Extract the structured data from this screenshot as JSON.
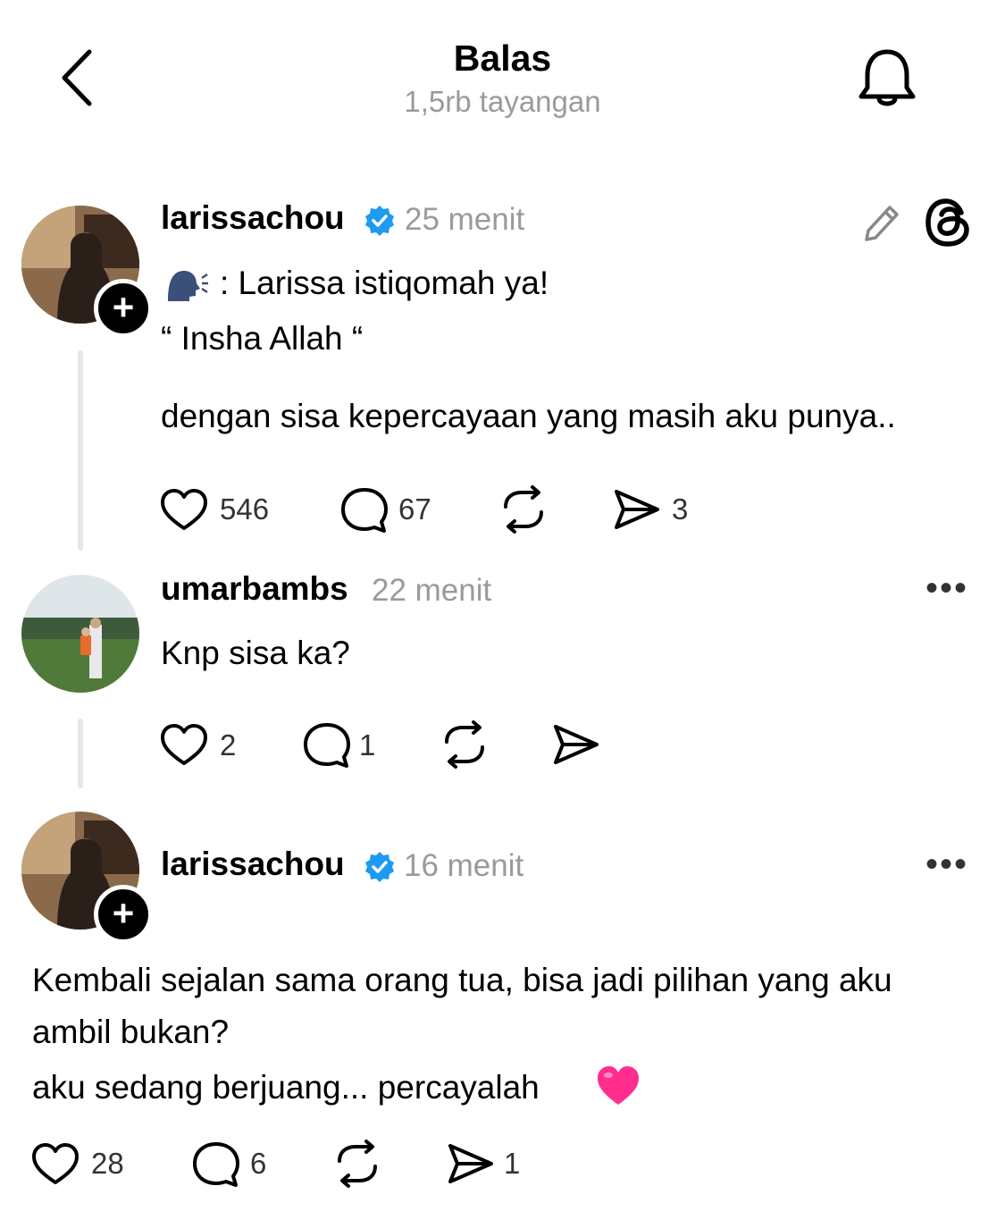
{
  "header": {
    "title": "Balas",
    "views": "1,5rb tayangan"
  },
  "posts": [
    {
      "username": "larissachou",
      "verified": true,
      "time": "25 menit",
      "lines": [
        ": Larissa istiqomah ya!",
        "“ Insha Allah “",
        "dengan sisa kepercayaan yang masih aku punya.."
      ],
      "likes": "546",
      "replies": "67",
      "shares": "3"
    },
    {
      "username": "umarbambs",
      "verified": false,
      "time": "22 menit",
      "lines": [
        "Knp sisa ka?"
      ],
      "likes": "2",
      "replies": "1"
    },
    {
      "username": "larissachou",
      "verified": true,
      "time": "16 menit",
      "lines": [
        "Kembali sejalan sama orang tua, bisa jadi pilihan yang aku",
        "ambil bukan?",
        "aku sedang berjuang... percayalah"
      ],
      "likes": "28",
      "replies": "6",
      "shares": "1"
    }
  ],
  "colors": {
    "verified": "#1d9bf0",
    "muted": "#9a9a9a",
    "heart_emoji": "#ff2e8e"
  }
}
